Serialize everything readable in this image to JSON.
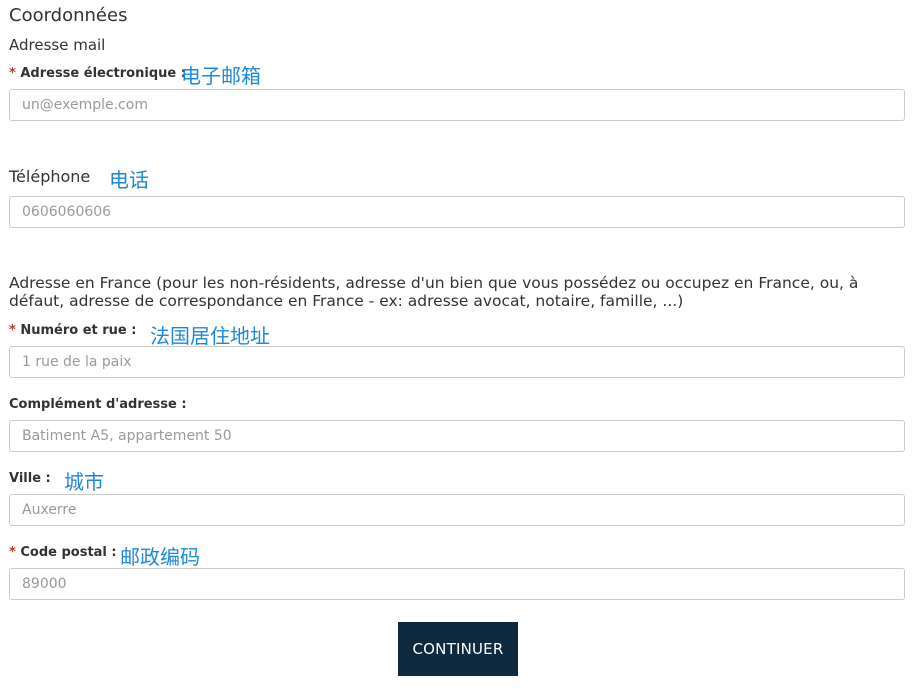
{
  "section": {
    "title": "Coordonnées",
    "subtitle": "Adresse mail"
  },
  "email": {
    "required_mark": "*",
    "label": "Adresse électronique :",
    "annotation": "电子邮箱",
    "placeholder": "un@exemple.com"
  },
  "phone": {
    "label": "Téléphone",
    "annotation": "电话",
    "placeholder": "0606060606"
  },
  "address": {
    "description": "Adresse en France (pour les non-résidents, adresse d'un bien que vous possédez ou occupez en France, ou, à défaut, adresse de correspondance en France - ex: adresse avocat, notaire, famille, ...)",
    "street": {
      "required_mark": "*",
      "label": "Numéro et rue :",
      "annotation": "法国居住地址",
      "placeholder": "1 rue de la paix"
    },
    "complement": {
      "label": "Complément d'adresse :",
      "placeholder": "Batiment A5, appartement 50"
    },
    "city": {
      "label": "Ville :",
      "annotation": "城市",
      "placeholder": "Auxerre"
    },
    "postal": {
      "required_mark": "*",
      "label": "Code postal :",
      "annotation": "邮政编码",
      "placeholder": "89000"
    }
  },
  "actions": {
    "continue_label": "CONTINUER"
  },
  "colors": {
    "annotation": "#1e88d8",
    "required": "#c0392b",
    "button_bg": "#0f2a3f"
  }
}
